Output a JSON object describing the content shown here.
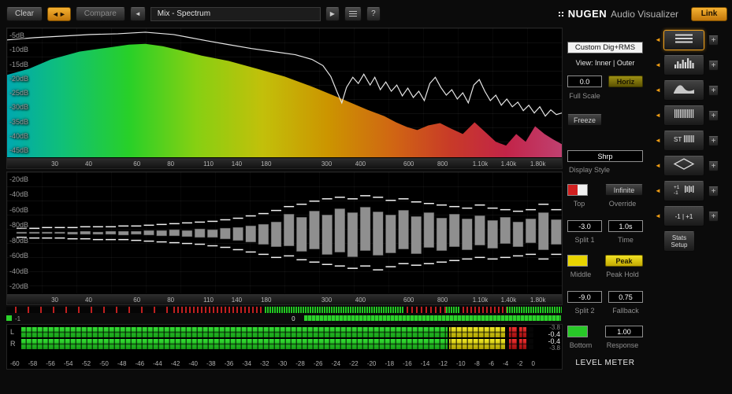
{
  "toolbar": {
    "clear": "Clear",
    "compare": "Compare",
    "preset_name": "Mix - Spectrum",
    "help": "?",
    "brand_name": "NUGEN",
    "brand_sub": "Audio Visualizer",
    "link": "Link"
  },
  "spectrum": {
    "db_labels": [
      "-5dB",
      "-10dB",
      "-15dB",
      "-20dB",
      "-25dB",
      "-30dB",
      "-35dB",
      "-40dB",
      "-45dB"
    ],
    "freq_labels": [
      {
        "t": "30",
        "p": 8.6
      },
      {
        "t": "40",
        "p": 14.7
      },
      {
        "t": "60",
        "p": 23.4
      },
      {
        "t": "80",
        "p": 29.5
      },
      {
        "t": "110",
        "p": 36.3
      },
      {
        "t": "140",
        "p": 41.4
      },
      {
        "t": "180",
        "p": 46.7
      },
      {
        "t": "300",
        "p": 57.6
      },
      {
        "t": "400",
        "p": 63.7
      },
      {
        "t": "600",
        "p": 72.4
      },
      {
        "t": "800",
        "p": 78.5
      },
      {
        "t": "1.10k",
        "p": 85.3
      },
      {
        "t": "1.40k",
        "p": 90.4
      },
      {
        "t": "1.80k",
        "p": 95.7
      }
    ],
    "gradient": [
      [
        "0",
        "#00a8b0"
      ],
      [
        "0.10",
        "#10c078"
      ],
      [
        "0.22",
        "#28d028"
      ],
      [
        "0.34",
        "#86d012"
      ],
      [
        "0.46",
        "#c2c00a"
      ],
      [
        "0.58",
        "#cc9400"
      ],
      [
        "0.70",
        "#d06414"
      ],
      [
        "0.80",
        "#c83a28"
      ],
      [
        "0.90",
        "#c22448"
      ],
      [
        "1",
        "#c04070"
      ]
    ],
    "fill_points": [
      [
        0,
        60
      ],
      [
        28,
        52
      ],
      [
        56,
        40
      ],
      [
        92,
        30
      ],
      [
        127,
        25
      ],
      [
        155,
        21
      ],
      [
        176,
        20
      ],
      [
        198,
        23
      ],
      [
        219,
        28
      ],
      [
        247,
        35
      ],
      [
        282,
        42
      ],
      [
        318,
        52
      ],
      [
        353,
        62
      ],
      [
        388,
        75
      ],
      [
        424,
        90
      ],
      [
        459,
        105
      ],
      [
        480,
        113
      ],
      [
        495,
        121
      ],
      [
        509,
        127
      ],
      [
        522,
        131
      ],
      [
        536,
        125
      ],
      [
        551,
        122
      ],
      [
        565,
        129
      ],
      [
        580,
        136
      ],
      [
        595,
        121
      ],
      [
        608,
        133
      ],
      [
        622,
        146
      ],
      [
        635,
        151
      ],
      [
        648,
        136
      ],
      [
        660,
        146
      ],
      [
        672,
        126
      ],
      [
        684,
        136
      ],
      [
        695,
        143
      ],
      [
        706,
        149
      ]
    ],
    "line_points": [
      [
        0,
        15
      ],
      [
        35,
        12
      ],
      [
        71,
        10
      ],
      [
        106,
        8
      ],
      [
        141,
        7
      ],
      [
        176,
        5
      ],
      [
        212,
        8
      ],
      [
        233,
        12
      ],
      [
        254,
        16
      ],
      [
        282,
        21
      ],
      [
        311,
        26
      ],
      [
        339,
        30
      ],
      [
        367,
        34
      ],
      [
        388,
        40
      ],
      [
        402,
        48
      ],
      [
        412,
        62
      ],
      [
        420,
        82
      ],
      [
        426,
        96
      ],
      [
        432,
        76
      ],
      [
        440,
        63
      ],
      [
        447,
        71
      ],
      [
        454,
        59
      ],
      [
        462,
        73
      ],
      [
        468,
        63
      ],
      [
        475,
        79
      ],
      [
        482,
        69
      ],
      [
        489,
        81
      ],
      [
        496,
        73
      ],
      [
        503,
        87
      ],
      [
        510,
        77
      ],
      [
        517,
        89
      ],
      [
        524,
        81
      ],
      [
        531,
        93
      ],
      [
        538,
        71
      ],
      [
        545,
        63
      ],
      [
        552,
        76
      ],
      [
        559,
        86
      ],
      [
        566,
        79
      ],
      [
        573,
        91
      ],
      [
        580,
        83
      ],
      [
        587,
        96
      ],
      [
        594,
        73
      ],
      [
        601,
        66
      ],
      [
        608,
        81
      ],
      [
        615,
        93
      ],
      [
        622,
        86
      ],
      [
        629,
        99
      ],
      [
        636,
        91
      ],
      [
        643,
        101
      ],
      [
        650,
        95
      ],
      [
        657,
        106
      ],
      [
        664,
        99
      ],
      [
        671,
        109
      ],
      [
        678,
        101
      ],
      [
        685,
        113
      ],
      [
        692,
        105
      ],
      [
        699,
        111
      ],
      [
        706,
        109
      ]
    ]
  },
  "histogram": {
    "db_labels": [
      "-20dB",
      "-40dB",
      "-60dB",
      "-80dB",
      "-80dB",
      "-60dB",
      "-40dB",
      "-20dB"
    ],
    "freq_labels": [
      {
        "t": "30",
        "p": 8.6
      },
      {
        "t": "40",
        "p": 14.7
      },
      {
        "t": "60",
        "p": 23.4
      },
      {
        "t": "80",
        "p": 29.5
      },
      {
        "t": "110",
        "p": 36.3
      },
      {
        "t": "140",
        "p": 41.4
      },
      {
        "t": "180",
        "p": 46.7
      },
      {
        "t": "300",
        "p": 57.6
      },
      {
        "t": "400",
        "p": 63.7
      },
      {
        "t": "600",
        "p": 72.4
      },
      {
        "t": "800",
        "p": 78.5
      },
      {
        "t": "1.10k",
        "p": 85.3
      },
      {
        "t": "1.40k",
        "p": 90.4
      },
      {
        "t": "1.80k",
        "p": 95.7
      }
    ],
    "bars": [
      [
        1,
        1,
        5,
        5
      ],
      [
        1,
        1,
        5,
        6
      ],
      [
        1,
        1,
        6,
        6
      ],
      [
        1,
        1,
        6,
        6
      ],
      [
        1,
        2,
        6,
        7
      ],
      [
        2,
        2,
        7,
        7
      ],
      [
        1,
        2,
        7,
        8
      ],
      [
        2,
        2,
        7,
        8
      ],
      [
        2,
        3,
        8,
        8
      ],
      [
        2,
        2,
        8,
        9
      ],
      [
        3,
        3,
        9,
        10
      ],
      [
        3,
        4,
        10,
        11
      ],
      [
        4,
        4,
        11,
        12
      ],
      [
        3,
        5,
        12,
        13
      ],
      [
        5,
        6,
        13,
        14
      ],
      [
        4,
        6,
        14,
        16
      ],
      [
        6,
        8,
        16,
        18
      ],
      [
        7,
        10,
        18,
        21
      ],
      [
        9,
        12,
        21,
        24
      ],
      [
        11,
        15,
        24,
        27
      ],
      [
        14,
        18,
        28,
        31
      ],
      [
        24,
        17,
        33,
        29
      ],
      [
        20,
        24,
        36,
        34
      ],
      [
        28,
        21,
        40,
        37
      ],
      [
        23,
        28,
        43,
        40
      ],
      [
        31,
        25,
        45,
        42
      ],
      [
        26,
        31,
        43,
        45
      ],
      [
        33,
        23,
        47,
        42
      ],
      [
        27,
        29,
        45,
        47
      ],
      [
        23,
        26,
        41,
        43
      ],
      [
        29,
        21,
        43,
        39
      ],
      [
        21,
        27,
        39,
        41
      ],
      [
        26,
        19,
        37,
        39
      ],
      [
        19,
        23,
        35,
        37
      ],
      [
        24,
        18,
        33,
        35
      ],
      [
        18,
        22,
        31,
        33
      ],
      [
        22,
        16,
        35,
        31
      ],
      [
        16,
        20,
        31,
        33
      ],
      [
        20,
        14,
        29,
        31
      ],
      [
        14,
        18,
        27,
        29
      ],
      [
        18,
        13,
        29,
        27
      ],
      [
        26,
        22,
        36,
        33
      ],
      [
        17,
        15,
        29,
        27
      ]
    ]
  },
  "tick_strip": {
    "segments": [
      {
        "from": 0.015,
        "to": 0.3,
        "gap": 16,
        "color": "#c02020"
      },
      {
        "from": 0.3,
        "to": 0.46,
        "gap": 5,
        "color": "#c02020"
      },
      {
        "from": 0.465,
        "to": 0.715,
        "gap": 3,
        "color": "#22c822"
      },
      {
        "from": 0.72,
        "to": 0.79,
        "gap": 6,
        "color": "#c02020"
      },
      {
        "from": 0.79,
        "to": 0.815,
        "gap": 3,
        "color": "#22c822"
      },
      {
        "from": 0.82,
        "to": 0.9,
        "gap": 5,
        "color": "#c02020"
      },
      {
        "from": 0.9,
        "to": 0.998,
        "gap": 3,
        "color": "#22c822"
      }
    ]
  },
  "correlation": {
    "left_label": "-1",
    "center_label": "0",
    "bar_from": 0.535,
    "bar_to": 0.997,
    "zero_pos": 51.3
  },
  "level_meter": {
    "channels": [
      "L",
      "R"
    ],
    "segments": {
      "green": [
        0,
        0.832
      ],
      "yellow": [
        0.836,
        0.945
      ],
      "red": [
        [
          0.952,
          0.968
        ],
        [
          0.972,
          0.986
        ]
      ]
    },
    "values": [
      "-3.8",
      "-0.4",
      "-0.4",
      "-3.8"
    ],
    "scale": [
      "-60",
      "-58",
      "-56",
      "-54",
      "-52",
      "-50",
      "-48",
      "-46",
      "-44",
      "-42",
      "-40",
      "-38",
      "-36",
      "-34",
      "-32",
      "-30",
      "-28",
      "-26",
      "-24",
      "-22",
      "-20",
      "-18",
      "-16",
      "-14",
      "-12",
      "-10",
      "-8",
      "-6",
      "-4",
      "-2",
      "0"
    ]
  },
  "panel": {
    "preset": "Custom Dig+RMS",
    "view_label": "View: Inner | Outer",
    "full_scale_value": "0.0",
    "horiz_button": "Horiz",
    "full_scale_label": "Full Scale",
    "freeze_button": "Freeze",
    "display_style_value": "Shrp",
    "display_style_label": "Display Style",
    "infinite_button": "Infinite",
    "top_label": "Top",
    "override_label": "Override",
    "split1_value": "-3.0",
    "time_value": "1.0s",
    "split1_label": "Split 1",
    "time_label": "Time",
    "peak_button": "Peak",
    "middle_label": "Middle",
    "peak_hold_label": "Peak Hold",
    "split2_value": "-9.0",
    "fallback_value": "0.75",
    "split2_label": "Split 2",
    "fallback_label": "Fallback",
    "response_value": "1.00",
    "bottom_label": "Bottom",
    "response_label": "Response",
    "section_label": "LEVEL METER",
    "colors": {
      "top_a": "#d02020",
      "top_b": "#f0f0f0",
      "middle": "#e8d400",
      "bottom": "#28c828"
    }
  },
  "dock": {
    "items": [
      {
        "name": "display-list",
        "icon": "menu",
        "selected": true
      },
      {
        "name": "histogram-view",
        "icon": "bars",
        "selected": false
      },
      {
        "name": "spectrum-view",
        "icon": "curve",
        "selected": false
      },
      {
        "name": "spectrogram-view",
        "icon": "vlines",
        "selected": false
      },
      {
        "name": "stereo-spectrum-view",
        "icon": "st",
        "selected": false
      },
      {
        "name": "vectorscope-view",
        "icon": "diamond",
        "selected": false
      },
      {
        "name": "meter-view",
        "icon": "minmax",
        "selected": false
      },
      {
        "name": "correlation-view",
        "icon": "text",
        "label": "-1 | +1",
        "selected": false
      }
    ],
    "stats_setup": "Stats Setup",
    "add_label": "+"
  }
}
